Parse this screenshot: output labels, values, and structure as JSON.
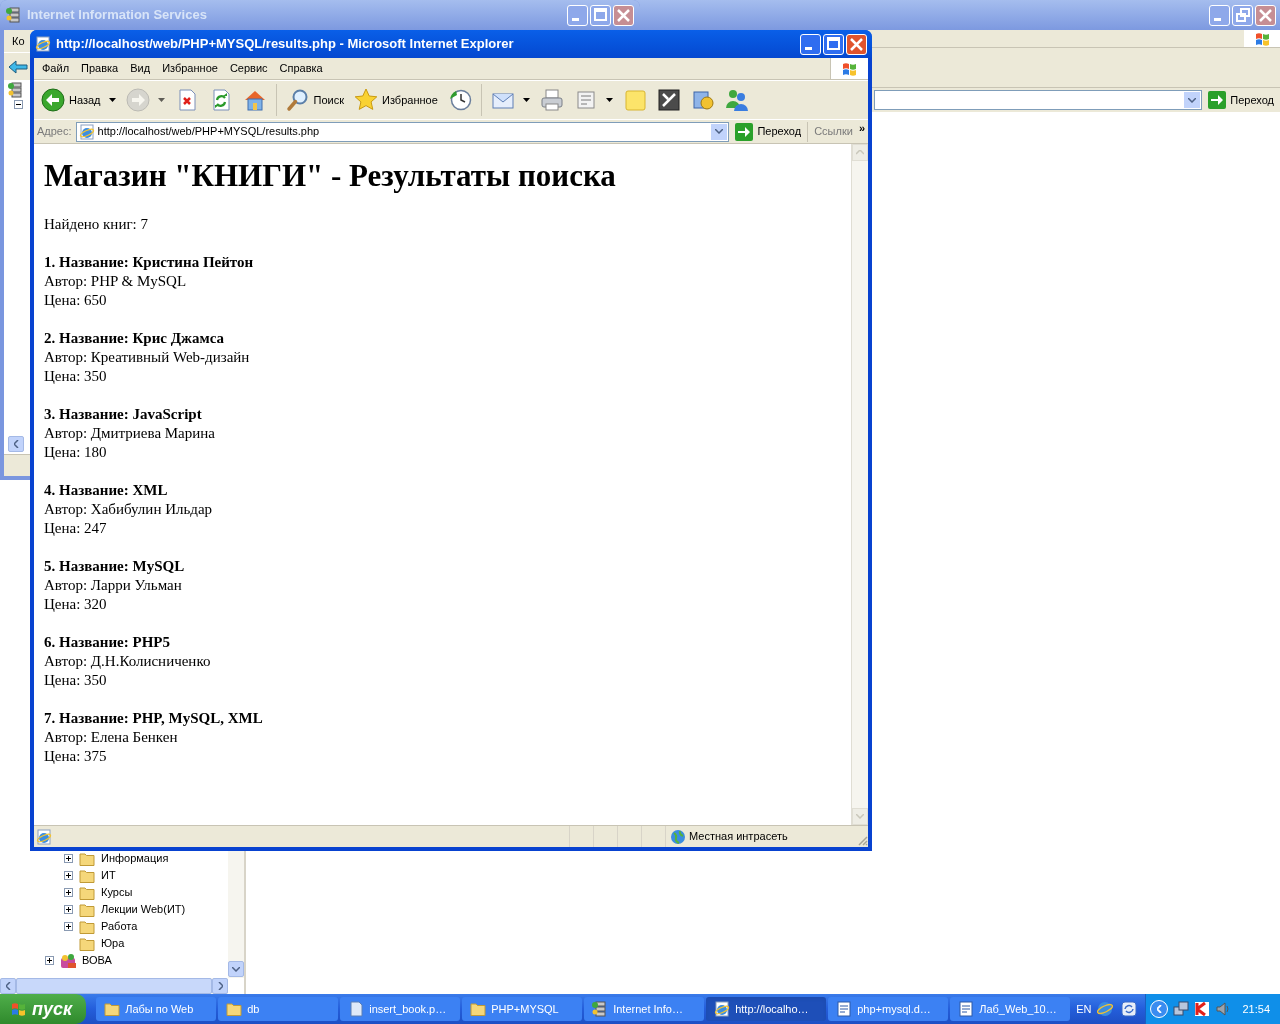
{
  "explorer_window": {
    "active": false,
    "go_button": "Переход",
    "tree": [
      {
        "children": [
          {
            "kind": "folder",
            "label": "Информация",
            "expandable": true
          },
          {
            "kind": "folder",
            "label": "ИТ",
            "expandable": true
          },
          {
            "kind": "folder",
            "label": "Курсы",
            "expandable": true
          },
          {
            "kind": "folder",
            "label": "Лекции Web(ИТ)",
            "expandable": true
          },
          {
            "kind": "folder",
            "label": "Работа",
            "expandable": true
          },
          {
            "kind": "folder",
            "label": "Юра",
            "expandable": false
          }
        ]
      },
      {
        "kind": "special",
        "label": "ВОВА",
        "expandable": true
      }
    ]
  },
  "iis_window": {
    "active": false,
    "title": "Internet Information Services",
    "menu_fragment": "Ко"
  },
  "ie_window": {
    "active": true,
    "title": "http://localhost/web/PHP+MYSQL/results.php - Microsoft Internet Explorer",
    "menu": [
      "Файл",
      "Правка",
      "Вид",
      "Избранное",
      "Сервис",
      "Справка"
    ],
    "toolbar": [
      {
        "kind": "back",
        "label": "Назад",
        "dropdown": true,
        "disabled": false
      },
      {
        "kind": "forward",
        "dropdown": true,
        "disabled": true
      },
      {
        "kind": "stop",
        "disabled": false
      },
      {
        "kind": "refresh",
        "disabled": false
      },
      {
        "kind": "home",
        "disabled": false
      },
      {
        "kind": "separator"
      },
      {
        "kind": "search",
        "label": "Поиск",
        "disabled": false
      },
      {
        "kind": "favorites",
        "label": "Избранное",
        "disabled": false
      },
      {
        "kind": "history",
        "disabled": false
      },
      {
        "kind": "separator"
      },
      {
        "kind": "mail",
        "dropdown": true,
        "disabled": false
      },
      {
        "kind": "print",
        "disabled": false
      },
      {
        "kind": "edit",
        "dropdown": true,
        "disabled": false
      },
      {
        "kind": "note",
        "disabled": false
      },
      {
        "kind": "tile",
        "disabled": false
      },
      {
        "kind": "media",
        "disabled": false
      },
      {
        "kind": "messenger",
        "disabled": false
      }
    ],
    "address_label": "Адрес:",
    "url": "http://localhost/web/PHP+MYSQL/results.php",
    "go_button": "Переход",
    "links": "Ссылки",
    "more": "»",
    "page": {
      "heading": "Магазин \"КНИГИ\" - Результаты поиска",
      "found": "Найдено книг: 7",
      "books": [
        {
          "title_line": "1. Название: Кристина Пейтон",
          "author_line": "Автор: PHP & MySQL",
          "price_line": "Цена: 650"
        },
        {
          "title_line": "2. Название: Крис Джамса",
          "author_line": "Автор: Креативный Web-дизайн",
          "price_line": "Цена: 350"
        },
        {
          "title_line": "3. Название: JavaScript",
          "author_line": "Автор: Дмитриева Марина",
          "price_line": "Цена: 180"
        },
        {
          "title_line": "4. Название: XML",
          "author_line": "Автор: Хабибулин Ильдар",
          "price_line": "Цена: 247"
        },
        {
          "title_line": "5. Название: MySQL",
          "author_line": "Автор: Ларри Ульман",
          "price_line": "Цена: 320"
        },
        {
          "title_line": "6. Название: PHP5",
          "author_line": "Автор: Д.Н.Колисниченко",
          "price_line": "Цена: 350"
        },
        {
          "title_line": "7. Название: PHP, MySQL, XML",
          "author_line": "Автор: Елена Бенкен",
          "price_line": "Цена: 375"
        }
      ]
    },
    "status": "Местная интрасеть"
  },
  "taskbar": {
    "start": "пуск",
    "tasks": [
      {
        "kind": "folder",
        "label": "Лабы по Web",
        "selected": false
      },
      {
        "kind": "folder",
        "label": "db",
        "selected": false
      },
      {
        "kind": "notepad",
        "label": "insert_book.p…",
        "selected": false
      },
      {
        "kind": "folder",
        "label": "PHP+MYSQL",
        "selected": false
      },
      {
        "kind": "iis",
        "label": "Internet Info…",
        "selected": false
      },
      {
        "kind": "ie",
        "label": "http://localho…",
        "selected": true
      },
      {
        "kind": "word",
        "label": "php+mysql.d…",
        "selected": false
      },
      {
        "kind": "word",
        "label": "Лаб_Web_10…",
        "selected": false
      }
    ],
    "language": "EN",
    "clock": "21:54"
  }
}
